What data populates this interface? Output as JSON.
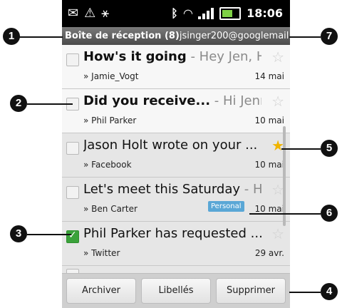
{
  "statusbar": {
    "time": "18:06",
    "icons": [
      "mail-icon",
      "alert-icon",
      "usb-icon",
      "bluetooth-icon",
      "wifi-icon",
      "signal-icon",
      "battery-icon"
    ]
  },
  "header": {
    "folder": "Boîte de réception (8)",
    "account": "jsinger200@googlemail"
  },
  "emails": [
    {
      "subject": "How's it going",
      "snippet": " - Hey Jen, H...",
      "sender": "» Jamie_Vogt",
      "date": "14 mai",
      "unread": true,
      "starred": false,
      "checked": false
    },
    {
      "subject": "Did you receive...",
      "snippet": " - Hi Jenn...",
      "sender": "» Phil Parker",
      "date": "10 mai",
      "unread": true,
      "starred": false,
      "checked": false
    },
    {
      "subject": "Jason Holt wrote on your ...",
      "snippet": " -...",
      "sender": "» Facebook",
      "date": "10 mai",
      "unread": false,
      "starred": true,
      "checked": false
    },
    {
      "subject": "Let's meet this Saturday",
      "snippet": " - Hi...",
      "sender": "» Ben Carter",
      "date": "10 mai",
      "label": "Personal",
      "unread": false,
      "starred": false,
      "checked": false
    },
    {
      "subject": "Phil Parker has requested ...",
      "snippet": "",
      "sender": "» Twitter",
      "date": "29 avr.",
      "unread": false,
      "starred": false,
      "checked": true
    }
  ],
  "bottombar": {
    "archive": "Archiver",
    "labels": "Libellés",
    "delete": "Supprimer"
  },
  "callouts": [
    "1",
    "2",
    "3",
    "4",
    "5",
    "6",
    "7"
  ]
}
